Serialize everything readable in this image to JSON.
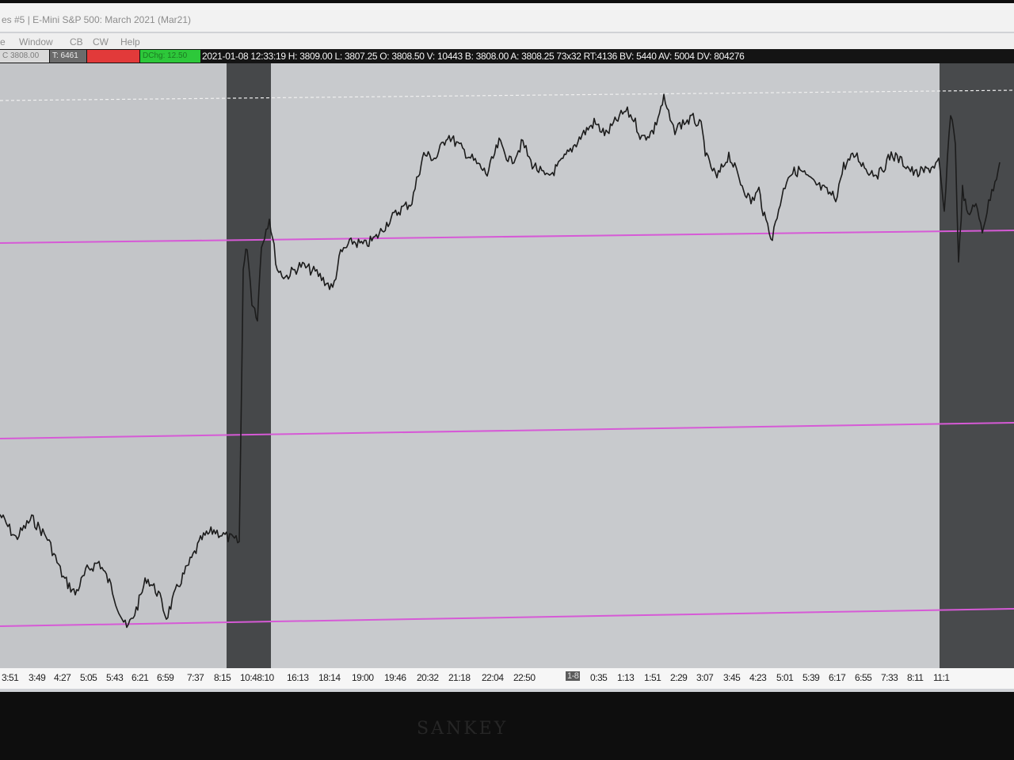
{
  "window": {
    "title": "es #5 | E-Mini S&P 500: March 2021 (Mar21)"
  },
  "menu": {
    "items": [
      "e",
      "Window",
      "CB",
      "CW",
      "Help"
    ]
  },
  "quote_bar": {
    "last_box": "C 3808.00",
    "trades_box": "T: 6461",
    "change_box": "DChg: 12.50",
    "stats": "2021-01-08 12:33:19 H: 3809.00 L: 3807.25 O: 3808.50 V: 10443 B: 3808.00 A: 3808.25 73x32 RT:4136 BV: 5440 AV: 5004 DV: 804276",
    "colors": {
      "red": "#e23a3a",
      "green": "#2dc83a",
      "gray": "#6b6b6b"
    }
  },
  "chart_data": {
    "type": "line",
    "series_color": "#1c1c1c",
    "reference_line_color": "#d65ad6",
    "session_shading": [
      "#404244",
      "#c3c5c8"
    ]
  },
  "time_axis": {
    "left_ticks": [
      "3:51",
      "3:49",
      "4:27",
      "5:05",
      "5:43",
      "6:21",
      "6:59",
      "7:37",
      "8:15",
      "10:48:10",
      "16:13",
      "18:14",
      "19:00",
      "19:46",
      "20:32",
      "21:18",
      "22:04",
      "22:50"
    ],
    "marker": "1-8",
    "right_ticks": [
      "0:35",
      "1:13",
      "1:51",
      "2:29",
      "3:07",
      "3:45",
      "4:23",
      "5:01",
      "5:39",
      "6:17",
      "6:55",
      "7:33",
      "8:11",
      "11:1"
    ]
  },
  "bezel": {
    "brand": "SANKEY"
  }
}
